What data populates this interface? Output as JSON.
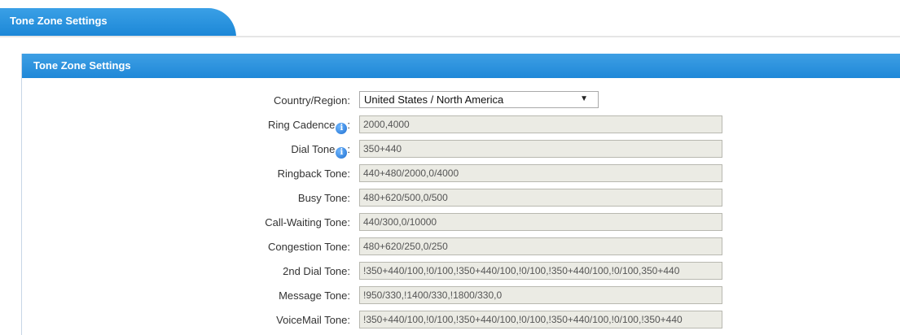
{
  "tab": {
    "label": "Tone Zone Settings"
  },
  "panel": {
    "title": "Tone Zone Settings"
  },
  "form": {
    "country": {
      "label": "Country/Region:",
      "value": "United States / North America"
    },
    "ring_cadence": {
      "label": "Ring Cadence",
      "value": "2000,4000"
    },
    "dial_tone": {
      "label": "Dial Tone",
      "value": "350+440"
    },
    "ringback_tone": {
      "label": "Ringback Tone:",
      "value": "440+480/2000,0/4000"
    },
    "busy_tone": {
      "label": "Busy Tone:",
      "value": "480+620/500,0/500"
    },
    "call_waiting_tone": {
      "label": "Call-Waiting Tone:",
      "value": "440/300,0/10000"
    },
    "congestion_tone": {
      "label": "Congestion Tone:",
      "value": "480+620/250,0/250"
    },
    "second_dial_tone": {
      "label": "2nd Dial Tone:",
      "value": "!350+440/100,!0/100,!350+440/100,!0/100,!350+440/100,!0/100,350+440"
    },
    "message_tone": {
      "label": "Message Tone:",
      "value": "!950/330,!1400/330,!1800/330,0"
    },
    "voicemail_tone": {
      "label": "VoiceMail Tone:",
      "value": "!350+440/100,!0/100,!350+440/100,!0/100,!350+440/100,!0/100,!350+440"
    }
  },
  "colors": {
    "accent": "#1f88d8",
    "readonly_bg": "#ebebe4"
  },
  "icons": {
    "info": "info-icon"
  }
}
